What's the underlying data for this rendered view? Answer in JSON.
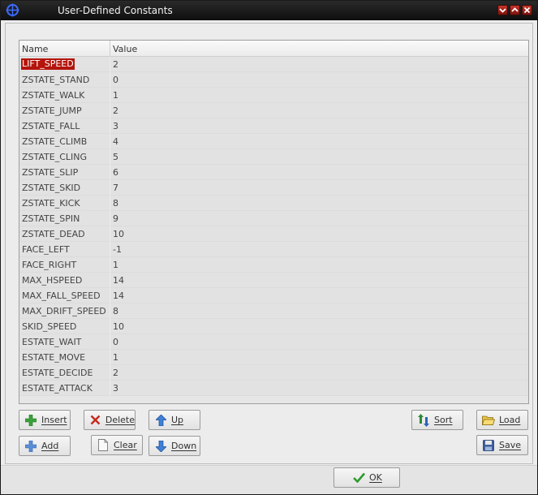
{
  "window": {
    "title": "User-Defined Constants"
  },
  "grid": {
    "columns": [
      "Name",
      "Value"
    ],
    "rows": [
      {
        "name": "LIFT_SPEED",
        "value": "2"
      },
      {
        "name": "ZSTATE_STAND",
        "value": "0"
      },
      {
        "name": "ZSTATE_WALK",
        "value": "1"
      },
      {
        "name": "ZSTATE_JUMP",
        "value": "2"
      },
      {
        "name": "ZSTATE_FALL",
        "value": "3"
      },
      {
        "name": "ZSTATE_CLIMB",
        "value": "4"
      },
      {
        "name": "ZSTATE_CLING",
        "value": "5"
      },
      {
        "name": "ZSTATE_SLIP",
        "value": "6"
      },
      {
        "name": "ZSTATE_SKID",
        "value": "7"
      },
      {
        "name": "ZSTATE_KICK",
        "value": "8"
      },
      {
        "name": "ZSTATE_SPIN",
        "value": "9"
      },
      {
        "name": "ZSTATE_DEAD",
        "value": "10"
      },
      {
        "name": "FACE_LEFT",
        "value": "-1"
      },
      {
        "name": "FACE_RIGHT",
        "value": "1"
      },
      {
        "name": "MAX_HSPEED",
        "value": "14"
      },
      {
        "name": "MAX_FALL_SPEED",
        "value": "14"
      },
      {
        "name": "MAX_DRIFT_SPEED",
        "value": "8"
      },
      {
        "name": "SKID_SPEED",
        "value": "10"
      },
      {
        "name": "ESTATE_WAIT",
        "value": "0"
      },
      {
        "name": "ESTATE_MOVE",
        "value": "1"
      },
      {
        "name": "ESTATE_DECIDE",
        "value": "2"
      },
      {
        "name": "ESTATE_ATTACK",
        "value": "3"
      }
    ]
  },
  "buttons": {
    "insert": "Insert",
    "delete": "Delete",
    "up": "Up",
    "sort": "Sort",
    "load": "Load",
    "add": "Add",
    "clear": "Clear",
    "down": "Down",
    "save": "Save",
    "ok": "OK"
  },
  "colors": {
    "selection": "#b4140b",
    "titlebar": "#161616"
  }
}
